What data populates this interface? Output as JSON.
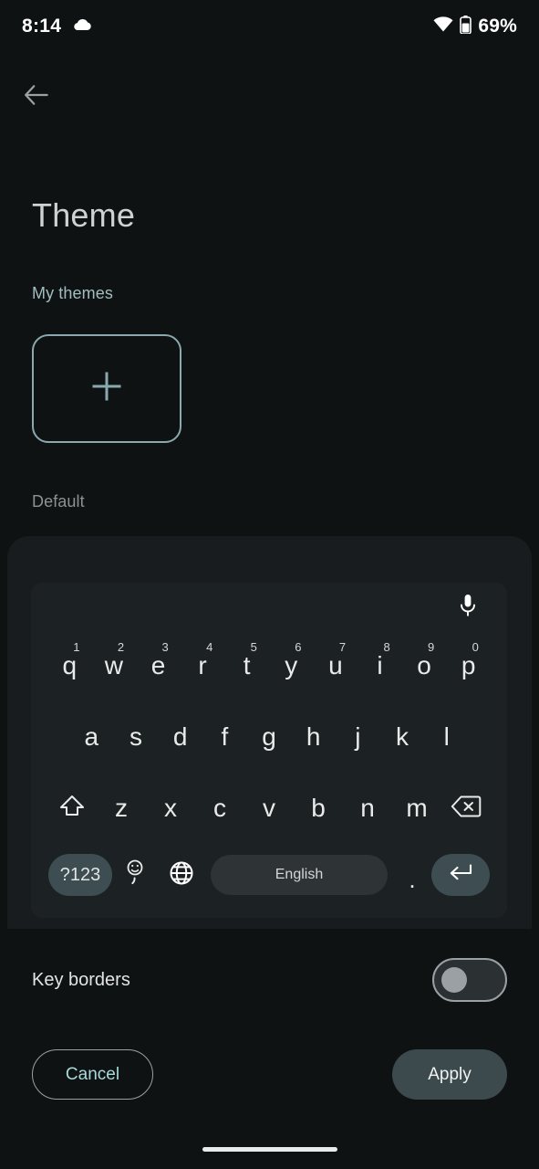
{
  "status_bar": {
    "time": "8:14",
    "cloud_icon": "cloud-icon",
    "wifi_icon": "wifi-icon",
    "battery_icon": "battery-icon",
    "battery_percent": "69%"
  },
  "nav": {
    "back_icon": "back-arrow-icon"
  },
  "header": {
    "title": "Theme"
  },
  "sections": {
    "my_themes_label": "My themes",
    "default_label": "Default",
    "add_theme_icon": "plus-icon"
  },
  "keyboard_preview": {
    "mic_icon": "microphone-icon",
    "row1": [
      {
        "letter": "q",
        "num": "1"
      },
      {
        "letter": "w",
        "num": "2"
      },
      {
        "letter": "e",
        "num": "3"
      },
      {
        "letter": "r",
        "num": "4"
      },
      {
        "letter": "t",
        "num": "5"
      },
      {
        "letter": "y",
        "num": "6"
      },
      {
        "letter": "u",
        "num": "7"
      },
      {
        "letter": "i",
        "num": "8"
      },
      {
        "letter": "o",
        "num": "9"
      },
      {
        "letter": "p",
        "num": "0"
      }
    ],
    "row2": [
      "a",
      "s",
      "d",
      "f",
      "g",
      "h",
      "j",
      "k",
      "l"
    ],
    "row3_letters": [
      "z",
      "x",
      "c",
      "v",
      "b",
      "n",
      "m"
    ],
    "shift_icon": "shift-icon",
    "backspace_icon": "backspace-icon",
    "symbols_key_label": "?123",
    "emoji_icon": "emoji-icon",
    "globe_icon": "globe-icon",
    "space_key_label": "English",
    "period_key_label": ".",
    "enter_icon": "enter-icon"
  },
  "settings": {
    "key_borders_label": "Key borders",
    "key_borders_enabled": false
  },
  "actions": {
    "cancel_label": "Cancel",
    "apply_label": "Apply"
  },
  "colors": {
    "background": "#0f1213",
    "accent_teal": "#a7dadb",
    "card": "#181c1e",
    "panel": "#1c2123",
    "key_accent": "#3d4d51",
    "apply_button": "#3c4a4d"
  }
}
